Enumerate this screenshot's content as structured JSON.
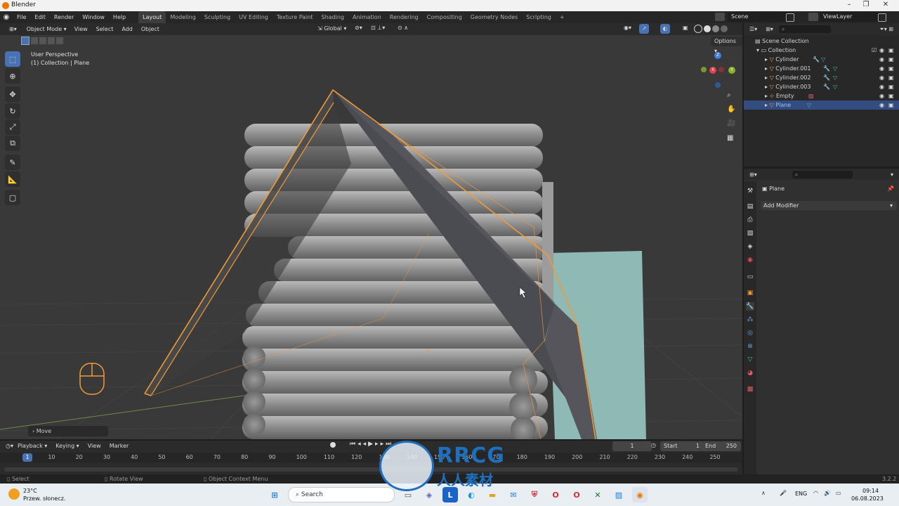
{
  "window": {
    "title": "Blender"
  },
  "menus": [
    "File",
    "Edit",
    "Render",
    "Window",
    "Help"
  ],
  "workspaces": [
    "Layout",
    "Modeling",
    "Sculpting",
    "UV Editing",
    "Texture Paint",
    "Shading",
    "Animation",
    "Rendering",
    "Compositing",
    "Geometry Nodes",
    "Scripting"
  ],
  "workspace_add": "+",
  "scene": {
    "name": "Scene",
    "view_layer": "ViewLayer"
  },
  "viewport_header": {
    "mode": "Object Mode",
    "menus": [
      "View",
      "Select",
      "Add",
      "Object"
    ],
    "transform_orientation": "Global",
    "options_label": "Options"
  },
  "viewport_overlay": {
    "perspective": "User Perspective",
    "collection": "(1) Collection | Plane"
  },
  "gizmo_axes": {
    "z": "Z",
    "x": "X",
    "y": "Y"
  },
  "last_operation": "Move",
  "outliner": {
    "root": "Scene Collection",
    "collection": "Collection",
    "items": [
      "Cylinder",
      "Cylinder.001",
      "Cylinder.002",
      "Cylinder.003",
      "Empty",
      "Plane"
    ],
    "selected_item": "Plane"
  },
  "properties": {
    "object_name": "Plane",
    "add_modifier": "Add Modifier"
  },
  "timeline": {
    "menus": [
      "Playback",
      "Keying",
      "View",
      "Marker"
    ],
    "current_frame": "1",
    "start_label": "Start",
    "start": "1",
    "end_label": "End",
    "end": "250",
    "ruler": [
      "10",
      "20",
      "30",
      "40",
      "50",
      "60",
      "70",
      "80",
      "90",
      "100",
      "110",
      "120",
      "130",
      "140",
      "150",
      "160",
      "170",
      "180",
      "190",
      "200",
      "210",
      "220",
      "230",
      "240",
      "250"
    ],
    "playhead": "1"
  },
  "statusbar": {
    "select": "Select",
    "rotate": "Rotate View",
    "context": "Object Context Menu",
    "version": "3.2.2"
  },
  "taskbar": {
    "weather_temp": "23°C",
    "weather_desc": "Przew. słonecz.",
    "search": "Search",
    "language": "ENG",
    "time": "09:14",
    "date": "06.08.2023"
  },
  "watermark": {
    "brand": "RRCG",
    "subtitle": "人人素材"
  },
  "colors": {
    "selection_outline": "#f29a36",
    "header_blue": "#4772b3",
    "viewport_bg": "#393939",
    "log_grey": "#8e8e8e",
    "water": "#8fb9b4"
  }
}
